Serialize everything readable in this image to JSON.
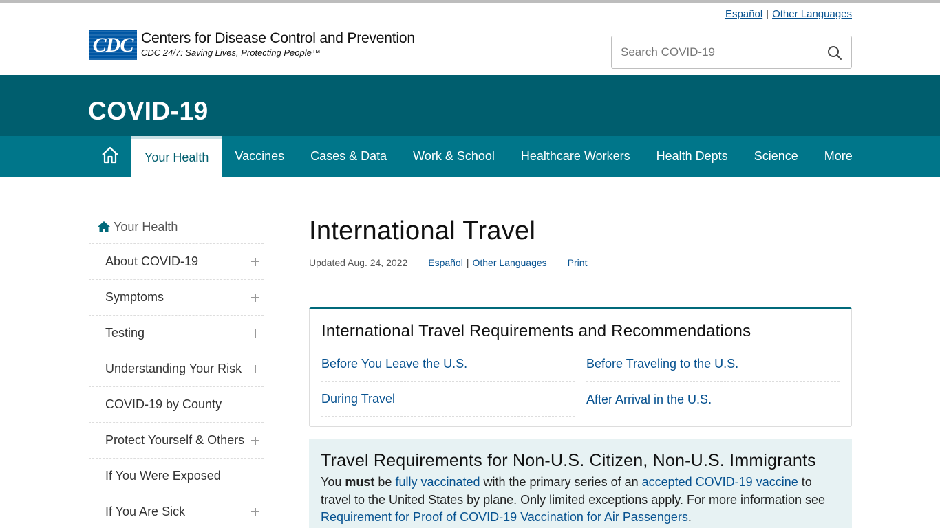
{
  "header": {
    "lang": {
      "espanol": "Español",
      "sep": "|",
      "other": "Other Languages"
    },
    "logo": {
      "mark": "CDC",
      "title": "Centers for Disease Control and Prevention",
      "tagline": "CDC 24/7: Saving Lives, Protecting People™"
    },
    "search": {
      "placeholder": "Search COVID-19",
      "icon": "search-icon"
    }
  },
  "banner": {
    "title": "COVID-19"
  },
  "nav": {
    "home_icon": "home-icon",
    "items": [
      {
        "label": "Your Health",
        "active": true
      },
      {
        "label": "Vaccines"
      },
      {
        "label": "Cases & Data"
      },
      {
        "label": "Work & School"
      },
      {
        "label": "Healthcare Workers"
      },
      {
        "label": "Health Depts"
      },
      {
        "label": "Science"
      },
      {
        "label": "More"
      }
    ]
  },
  "sidebar": {
    "home_label": "Your Health",
    "items": [
      {
        "label": "About COVID-19",
        "expandable": true
      },
      {
        "label": "Symptoms",
        "expandable": true
      },
      {
        "label": "Testing",
        "expandable": true
      },
      {
        "label": "Understanding Your Risk",
        "expandable": true
      },
      {
        "label": "COVID-19 by County",
        "expandable": false
      },
      {
        "label": "Protect Yourself & Others",
        "expandable": true
      },
      {
        "label": "If You Were Exposed",
        "expandable": false
      },
      {
        "label": "If You Are Sick",
        "expandable": true
      }
    ]
  },
  "main": {
    "title": "International Travel",
    "updated": "Updated Aug. 24, 2022",
    "espanol": "Español",
    "pipe": "|",
    "other_languages": "Other Languages",
    "print": "Print",
    "card": {
      "heading": "International Travel Requirements and Recommendations",
      "links": [
        "Before You Leave the U.S.",
        "Before Traveling to the U.S.",
        "During Travel",
        "After Arrival in the U.S."
      ]
    },
    "nonus": {
      "heading": "Travel Requirements for Non-U.S. Citizen, Non-U.S. Immigrants",
      "t1": "You ",
      "must": "must",
      "t2": " be ",
      "link1": "fully vaccinated",
      "t3": " with the primary series of an ",
      "link2": "accepted COVID-19 vaccine",
      "t4": " to travel to the United States by plane. Only limited exceptions apply. For more information see ",
      "link3": "Requirement for Proof of COVID-19 Vaccination for Air Passengers",
      "t5": "."
    }
  },
  "colors": {
    "banner": "#005e6e",
    "nav": "#00768a",
    "link": "#075290",
    "callout": "#e7f2f3"
  }
}
